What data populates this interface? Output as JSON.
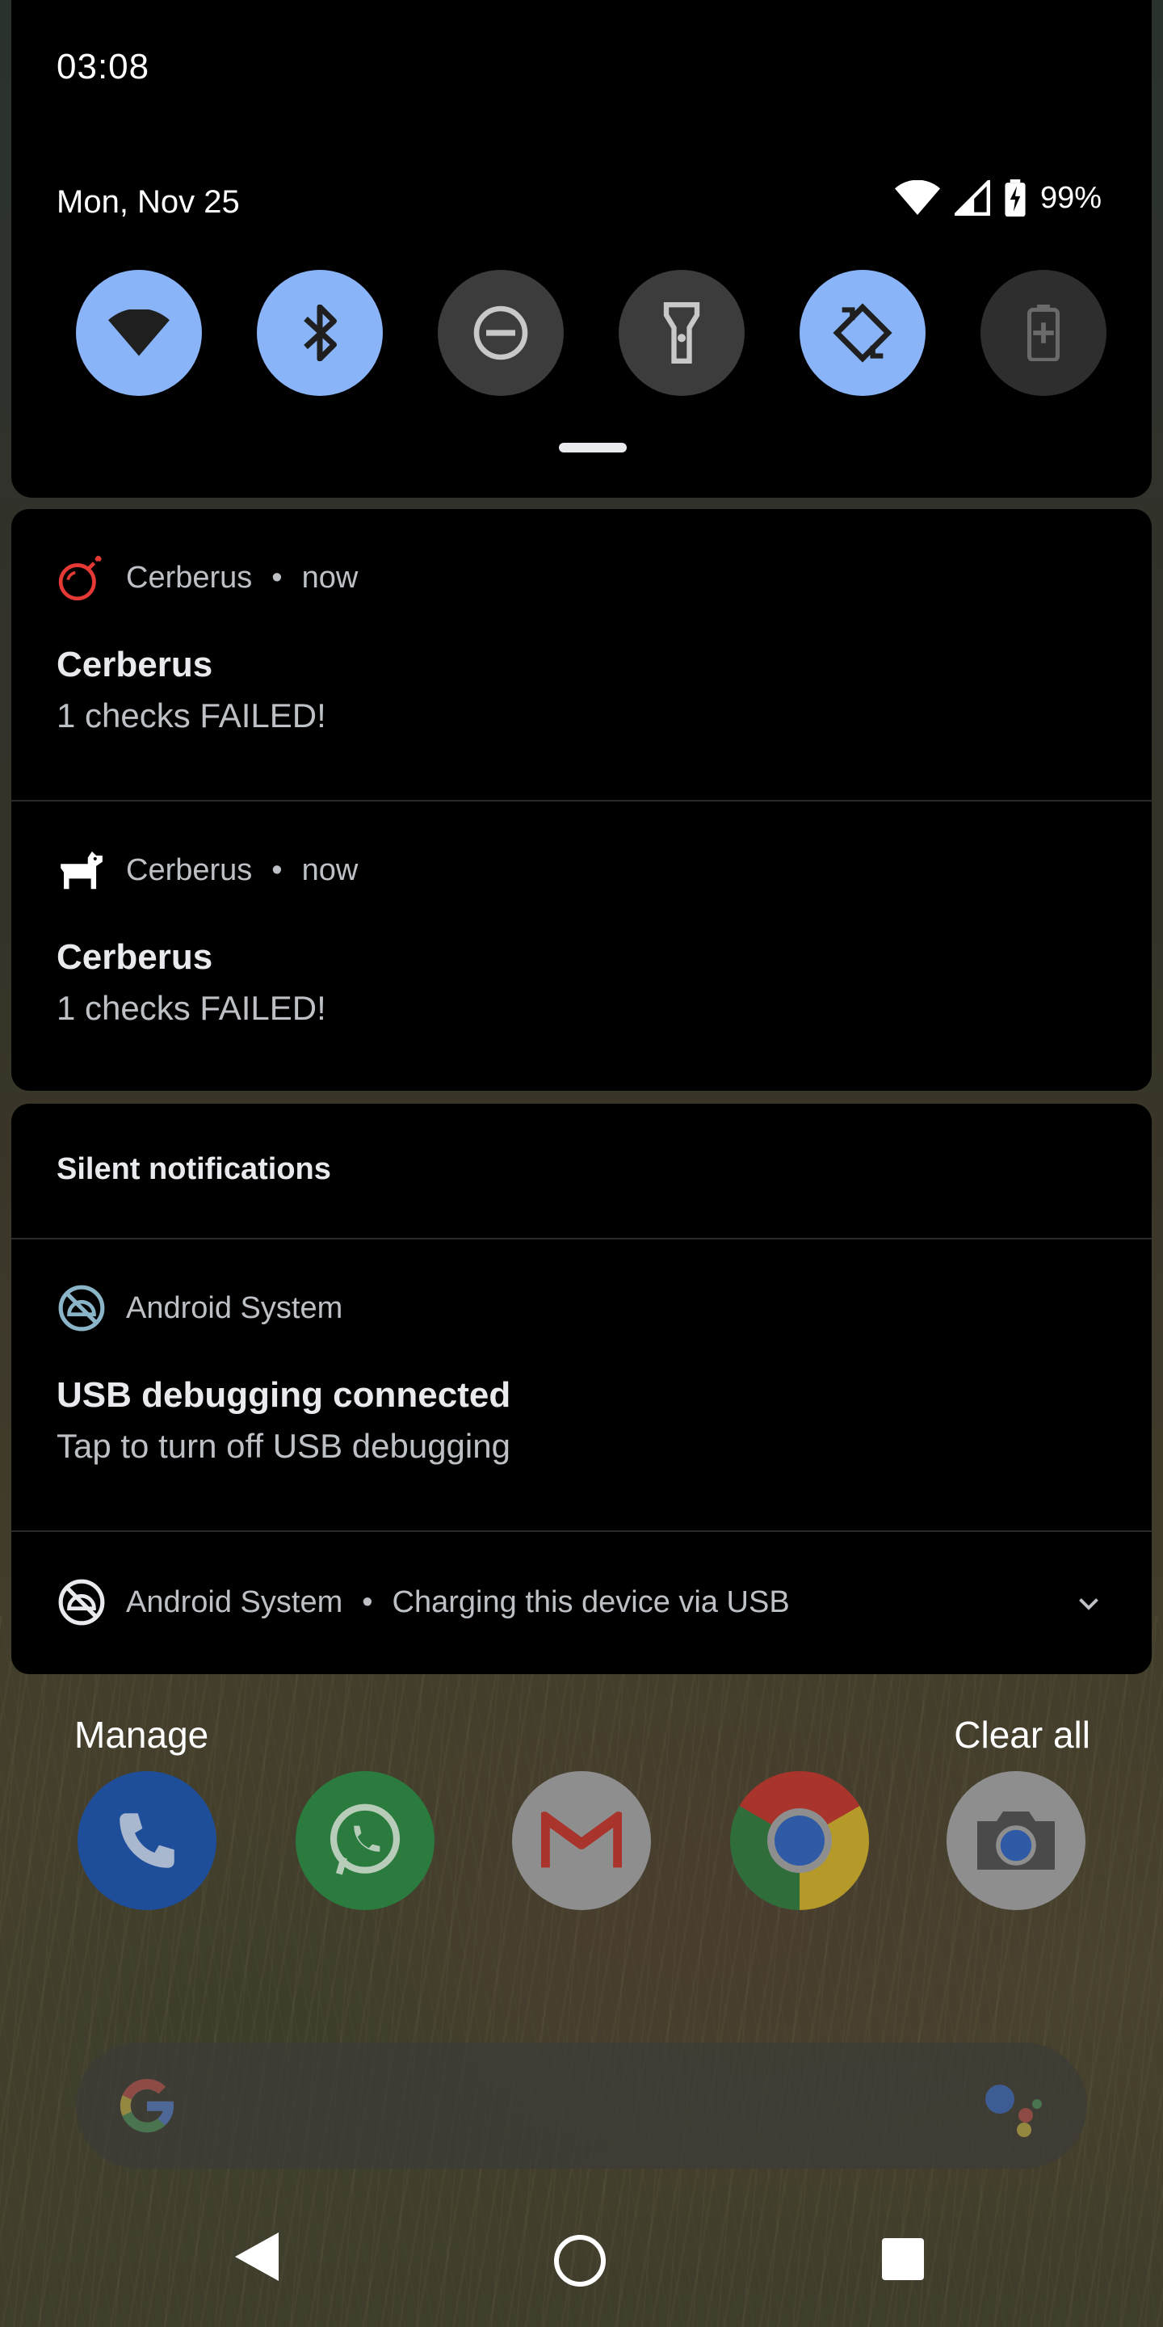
{
  "status_bar": {
    "time": "03:08",
    "date": "Mon, Nov 25",
    "battery_percent": "99%",
    "icons": [
      "wifi-icon",
      "cell-signal-icon",
      "battery-charging-icon"
    ]
  },
  "quick_settings": {
    "tiles": [
      {
        "name": "wifi",
        "icon": "wifi-icon",
        "state": "on"
      },
      {
        "name": "bluetooth",
        "icon": "bluetooth-icon",
        "state": "on"
      },
      {
        "name": "do-not-disturb",
        "icon": "dnd-icon",
        "state": "off"
      },
      {
        "name": "flashlight",
        "icon": "flashlight-icon",
        "state": "off"
      },
      {
        "name": "auto-rotate",
        "icon": "auto-rotate-icon",
        "state": "on"
      },
      {
        "name": "battery-saver",
        "icon": "battery-saver-icon",
        "state": "disabled"
      }
    ],
    "accent_color": "#8ab4f8"
  },
  "notifications": [
    {
      "app": "Cerberus",
      "time": "now",
      "title": "Cerberus",
      "text": "1 checks FAILED!",
      "icon": "bomb-icon",
      "icon_color": "#e53935"
    },
    {
      "app": "Cerberus",
      "time": "now",
      "title": "Cerberus",
      "text": "1 checks FAILED!",
      "icon": "dog-icon",
      "icon_color": "#ffffff"
    }
  ],
  "silent": {
    "header": "Silent notifications",
    "items": [
      {
        "app": "Android System",
        "title": "USB debugging connected",
        "text": "Tap to turn off USB debugging",
        "icon": "android-debug-icon"
      },
      {
        "app": "Android System",
        "summary": "Charging this device via USB",
        "icon": "android-debug-icon",
        "expand_icon": "chevron-down-icon"
      }
    ]
  },
  "actions": {
    "manage": "Manage",
    "clear_all": "Clear all"
  },
  "dock": [
    "phone-icon",
    "whatsapp-icon",
    "gmail-icon",
    "chrome-icon",
    "camera-icon"
  ],
  "search": {
    "logo": "google-g-icon",
    "assistant": "assistant-icon"
  },
  "nav": [
    "back-icon",
    "home-icon",
    "recents-icon"
  ],
  "separator": "•"
}
